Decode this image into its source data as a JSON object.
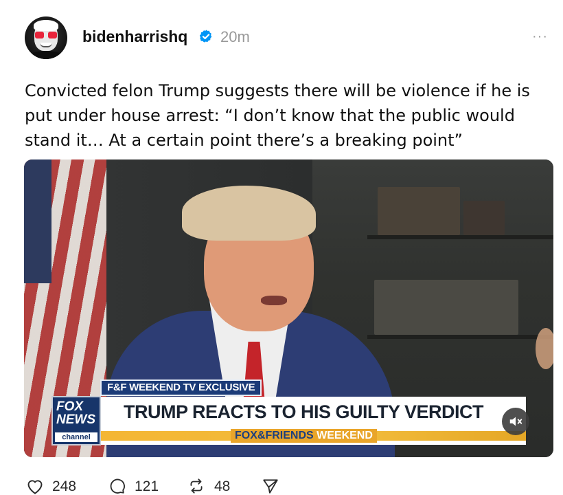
{
  "post": {
    "username": "bidenharrishq",
    "time": "20m",
    "more": "···",
    "text": "Convicted felon Trump suggests there will be violence if he is put under house arrest: “I don’t know that the public would stand it… At a certain point there’s a breaking point”"
  },
  "media": {
    "tag": "F&F WEEKEND TV EXCLUSIVE",
    "headline": "TRUMP REACTS TO HIS GUILTY VERDICT",
    "show_a": "FOX&FRIENDS",
    "show_b": "WEEKEND",
    "logo_fox": "FOX",
    "logo_news": "NEWS",
    "logo_channel": "channel"
  },
  "actions": {
    "likes": "248",
    "replies": "121",
    "reposts": "48"
  },
  "colors": {
    "verified": "#0095f6",
    "text": "#101010",
    "muted": "#999999"
  },
  "icons": [
    "verified-badge-icon",
    "more-icon",
    "mute-icon",
    "heart-icon",
    "comment-icon",
    "repost-icon",
    "share-icon"
  ]
}
